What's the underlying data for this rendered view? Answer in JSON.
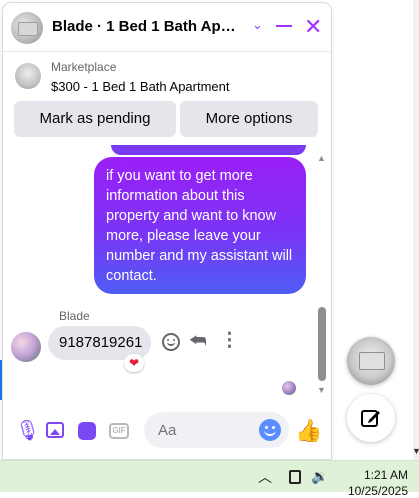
{
  "chat_header": {
    "title": "Blade · 1 Bed 1 Bath Apartment",
    "chevron_icon": "chevron-down-icon",
    "minimize_icon": "minimize-icon",
    "close_icon": "close-icon",
    "accent_color": "#a033ff"
  },
  "listing": {
    "label": "Marketplace",
    "title": "$300 - 1 Bed 1 Bath Apartment"
  },
  "actions": {
    "mark_pending": "Mark as pending",
    "more_options": "More options"
  },
  "messages": [
    {
      "direction": "outgoing",
      "text": "if you want to get more information about this property and want to know more, please leave your number and my assistant will contact."
    },
    {
      "direction": "incoming",
      "sender": "Blade",
      "text": "9187819261",
      "reaction": "❤"
    }
  ],
  "message_actions": {
    "react_icon": "smiley-icon",
    "reply_icon": "reply-icon",
    "more_icon": "more-vertical-icon"
  },
  "composer": {
    "placeholder": "Aa",
    "gif_label": "GIF",
    "icons": [
      "mic-icon",
      "photo-icon",
      "sticker-icon",
      "gif-icon",
      "emoji-icon",
      "thumbs-up-icon"
    ]
  },
  "taskbar": {
    "time": "1:21 AM",
    "date": "10/25/2025",
    "color": "#dff2d8"
  }
}
